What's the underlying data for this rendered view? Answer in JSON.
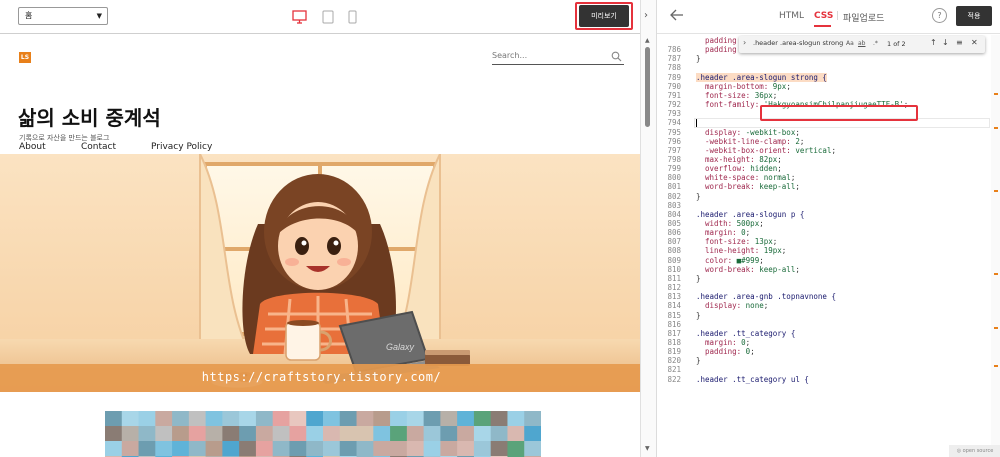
{
  "left_toolbar": {
    "page_select_value": "홈",
    "preview_button": "미리보기"
  },
  "blog": {
    "logo": "LS",
    "search_placeholder": "Search...",
    "title": "삶의 소비 중계석",
    "subtitle": "기록으로 자산을 만드는 블로그",
    "nav": [
      "About",
      "Contact",
      "Privacy Policy"
    ],
    "hero_url": "https://craftstory.tistory.com/",
    "laptop_brand": "Galaxy"
  },
  "editor": {
    "tabs": {
      "html": "HTML",
      "css": "CSS",
      "upload": "파일업로드"
    },
    "help": "?",
    "apply_button": "적용",
    "find": {
      "query": ".header .area-slogun strong {",
      "opt_case": "Aa",
      "opt_word": "ab",
      "opt_regex": ".*",
      "count": "1 of 2"
    },
    "footer_badge": "◎ open source",
    "lines": [
      {
        "n": "",
        "segs": [
          {
            "t": "  padding",
            "c": "prop"
          }
        ]
      },
      {
        "n": "786",
        "segs": [
          {
            "t": "  padding",
            "c": "prop"
          }
        ]
      },
      {
        "n": "787",
        "segs": [
          {
            "t": "}",
            "c": "punc"
          }
        ]
      },
      {
        "n": "788",
        "segs": []
      },
      {
        "n": "789",
        "segs": [
          {
            "t": ".header .area-slogun strong {",
            "c": "sel hl-bg"
          }
        ]
      },
      {
        "n": "790",
        "segs": [
          {
            "t": "  margin-bottom: ",
            "c": "prop"
          },
          {
            "t": "9px",
            "c": "val"
          },
          {
            "t": ";",
            "c": "punc"
          }
        ]
      },
      {
        "n": "791",
        "segs": [
          {
            "t": "  font-size: ",
            "c": "prop"
          },
          {
            "t": "36px",
            "c": "val"
          },
          {
            "t": ";",
            "c": "punc"
          }
        ]
      },
      {
        "n": "792",
        "segs": [
          {
            "t": "  font-family: ",
            "c": "prop"
          },
          {
            "t": "'HakgyoansimChilpanjiugaeTTF-B'",
            "c": "str"
          },
          {
            "t": ";",
            "c": "punc"
          }
        ]
      },
      {
        "n": "793",
        "segs": []
      },
      {
        "n": "794",
        "segs": []
      },
      {
        "n": "795",
        "segs": [
          {
            "t": "  display: ",
            "c": "prop"
          },
          {
            "t": "-webkit-box",
            "c": "val"
          },
          {
            "t": ";",
            "c": "punc"
          }
        ]
      },
      {
        "n": "796",
        "segs": [
          {
            "t": "  -webkit-line-clamp: ",
            "c": "prop"
          },
          {
            "t": "2",
            "c": "val"
          },
          {
            "t": ";",
            "c": "punc"
          }
        ]
      },
      {
        "n": "797",
        "segs": [
          {
            "t": "  -webkit-box-orient: ",
            "c": "prop"
          },
          {
            "t": "vertical",
            "c": "val"
          },
          {
            "t": ";",
            "c": "punc"
          }
        ]
      },
      {
        "n": "798",
        "segs": [
          {
            "t": "  max-height: ",
            "c": "prop"
          },
          {
            "t": "82px",
            "c": "val"
          },
          {
            "t": ";",
            "c": "punc"
          }
        ]
      },
      {
        "n": "799",
        "segs": [
          {
            "t": "  overflow: ",
            "c": "prop"
          },
          {
            "t": "hidden",
            "c": "val"
          },
          {
            "t": ";",
            "c": "punc"
          }
        ]
      },
      {
        "n": "800",
        "segs": [
          {
            "t": "  white-space: ",
            "c": "prop"
          },
          {
            "t": "normal",
            "c": "val"
          },
          {
            "t": ";",
            "c": "punc"
          }
        ]
      },
      {
        "n": "801",
        "segs": [
          {
            "t": "  word-break: ",
            "c": "prop"
          },
          {
            "t": "keep-all",
            "c": "val"
          },
          {
            "t": ";",
            "c": "punc"
          }
        ]
      },
      {
        "n": "802",
        "segs": [
          {
            "t": "}",
            "c": "punc"
          }
        ]
      },
      {
        "n": "803",
        "segs": []
      },
      {
        "n": "804",
        "segs": [
          {
            "t": ".header .area-slogun p {",
            "c": "sel"
          }
        ]
      },
      {
        "n": "805",
        "segs": [
          {
            "t": "  width: ",
            "c": "prop"
          },
          {
            "t": "500px",
            "c": "val"
          },
          {
            "t": ";",
            "c": "punc"
          }
        ]
      },
      {
        "n": "806",
        "segs": [
          {
            "t": "  margin: ",
            "c": "prop"
          },
          {
            "t": "0",
            "c": "val"
          },
          {
            "t": ";",
            "c": "punc"
          }
        ]
      },
      {
        "n": "807",
        "segs": [
          {
            "t": "  font-size: ",
            "c": "prop"
          },
          {
            "t": "13px",
            "c": "val"
          },
          {
            "t": ";",
            "c": "punc"
          }
        ]
      },
      {
        "n": "808",
        "segs": [
          {
            "t": "  line-height: ",
            "c": "prop"
          },
          {
            "t": "19px",
            "c": "val"
          },
          {
            "t": ";",
            "c": "punc"
          }
        ]
      },
      {
        "n": "809",
        "segs": [
          {
            "t": "  color: ",
            "c": "prop"
          },
          {
            "t": "■#999",
            "c": "val"
          },
          {
            "t": ";",
            "c": "punc"
          }
        ]
      },
      {
        "n": "810",
        "segs": [
          {
            "t": "  word-break: ",
            "c": "prop"
          },
          {
            "t": "keep-all",
            "c": "val"
          },
          {
            "t": ";",
            "c": "punc"
          }
        ]
      },
      {
        "n": "811",
        "segs": [
          {
            "t": "}",
            "c": "punc"
          }
        ]
      },
      {
        "n": "812",
        "segs": []
      },
      {
        "n": "813",
        "segs": [
          {
            "t": ".header .area-gnb .topnavnone {",
            "c": "sel"
          }
        ]
      },
      {
        "n": "814",
        "segs": [
          {
            "t": "  display: ",
            "c": "prop"
          },
          {
            "t": "none",
            "c": "val"
          },
          {
            "t": ";",
            "c": "punc"
          }
        ]
      },
      {
        "n": "815",
        "segs": [
          {
            "t": "}",
            "c": "punc"
          }
        ]
      },
      {
        "n": "816",
        "segs": []
      },
      {
        "n": "817",
        "segs": [
          {
            "t": ".header .tt_category {",
            "c": "sel"
          }
        ]
      },
      {
        "n": "818",
        "segs": [
          {
            "t": "  margin: ",
            "c": "prop"
          },
          {
            "t": "0",
            "c": "val"
          },
          {
            "t": ";",
            "c": "punc"
          }
        ]
      },
      {
        "n": "819",
        "segs": [
          {
            "t": "  padding: ",
            "c": "prop"
          },
          {
            "t": "0",
            "c": "val"
          },
          {
            "t": ";",
            "c": "punc"
          }
        ]
      },
      {
        "n": "820",
        "segs": [
          {
            "t": "}",
            "c": "punc"
          }
        ]
      },
      {
        "n": "821",
        "segs": []
      },
      {
        "n": "822",
        "segs": [
          {
            "t": ".header .tt_category ul {",
            "c": "sel"
          }
        ]
      }
    ]
  },
  "colors": {
    "accent_red": "#e5323c",
    "logo_orange": "#e8801a"
  }
}
